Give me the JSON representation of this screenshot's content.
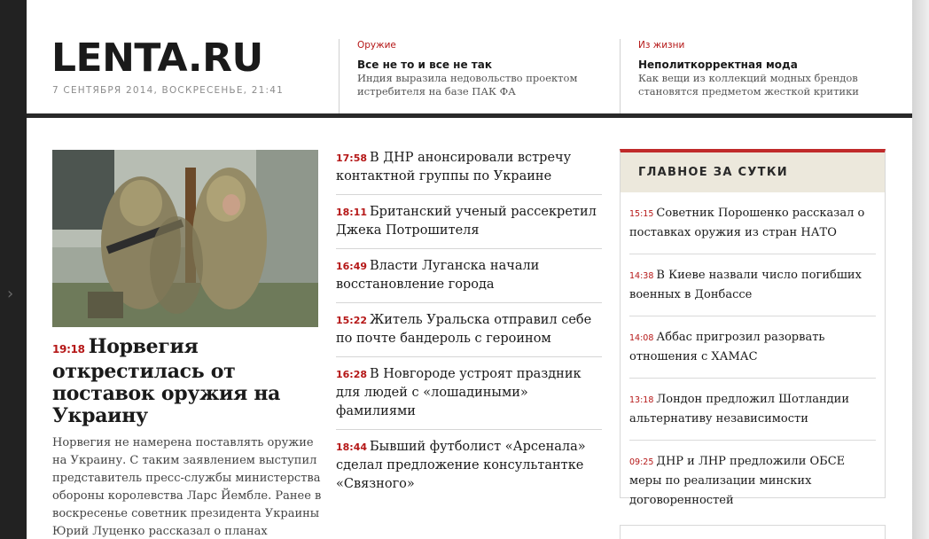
{
  "header": {
    "logo": "LENTA.RU",
    "date": "7 СЕНТЯБРЯ 2014, ВОСКРЕСЕНЬЕ, 21:41",
    "topics": [
      {
        "rubric": "Оружие",
        "title": "Все не то и все не так",
        "desc": "Индия выразила недовольство проектом истребителя на базе ПАК ФА"
      },
      {
        "rubric": "Из жизни",
        "title": "Неполиткорректная мода",
        "desc": "Как вещи из коллекций модных брендов становятся предметом жесткой критики"
      }
    ]
  },
  "sidebar": {
    "arrow": "›"
  },
  "main": {
    "photo": "soldiers-in-ghillie-suits-photo",
    "time": "19:18",
    "title": "Норвегия открестилась от поставок оружия на Украину",
    "lead": "Норвегия не намерена поставлять оружие на Украину. С таким заявлением выступил представитель пресс-службы министерства обороны королевства Ларс Йембле. Ранее в воскресенье советник президента Украины Юрий Луценко рассказал о планах"
  },
  "news": [
    {
      "time": "17:58",
      "title": "В ДНР анонсировали встречу контактной группы по Украине"
    },
    {
      "time": "18:11",
      "title": "Британский ученый рассекретил Джека Потрошителя"
    },
    {
      "time": "16:49",
      "title": "Власти Луганска начали восстановление города"
    },
    {
      "time": "15:22",
      "title": "Житель Уральска отправил себе по почте бандероль с героином"
    },
    {
      "time": "16:28",
      "title": "В Новгороде устроят праздник для людей с «лошадиными» фамилиями"
    },
    {
      "time": "18:44",
      "title": "Бывший футболист «Арсенала» сделал предложение консультантке «Связного»"
    }
  ],
  "top_day": {
    "heading": "ГЛАВНОЕ ЗА СУТКИ",
    "items": [
      {
        "time": "15:15",
        "title": "Советник Порошенко рассказал о поставках оружия из стран НАТО"
      },
      {
        "time": "14:38",
        "title": "В Киеве назвали число погибших военных в Донбассе"
      },
      {
        "time": "14:08",
        "title": "Аббас пригрозил разорвать отношения с ХАМАС"
      },
      {
        "time": "13:18",
        "title": "Лондон предложил Шотландии альтернативу независимости"
      },
      {
        "time": "09:25",
        "title": "ДНР и ЛНР предложили ОБСЕ меры по реализации минских договоренностей"
      }
    ]
  },
  "colors": {
    "accent": "#b51717",
    "box_border": "#c02a2a",
    "box_head_bg": "#ece8dc",
    "rule": "#292929"
  }
}
